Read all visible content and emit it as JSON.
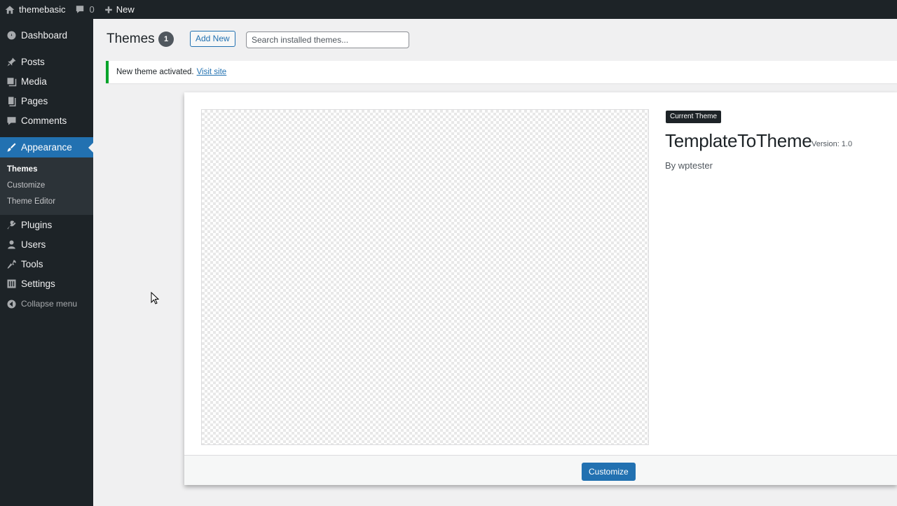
{
  "admin_bar": {
    "site_name": "themebasic",
    "comments_count": "0",
    "new_label": "New"
  },
  "sidebar": {
    "items": [
      {
        "label": "Dashboard",
        "icon": "dashboard-icon"
      },
      {
        "label": "Posts",
        "icon": "pushpin-icon"
      },
      {
        "label": "Media",
        "icon": "media-icon"
      },
      {
        "label": "Pages",
        "icon": "pages-icon"
      },
      {
        "label": "Comments",
        "icon": "comment-icon"
      },
      {
        "label": "Appearance",
        "icon": "paintbrush-icon",
        "active": true
      },
      {
        "label": "Plugins",
        "icon": "plugin-icon"
      },
      {
        "label": "Users",
        "icon": "user-icon"
      },
      {
        "label": "Tools",
        "icon": "wrench-icon"
      },
      {
        "label": "Settings",
        "icon": "settings-icon"
      }
    ],
    "appearance_submenu": [
      "Themes",
      "Customize",
      "Theme Editor"
    ],
    "collapse_label": "Collapse menu"
  },
  "header": {
    "title": "Themes",
    "count": "1",
    "add_new_label": "Add New",
    "search_placeholder": "Search installed themes..."
  },
  "notice": {
    "text": "New theme activated.",
    "link": "Visit site"
  },
  "theme": {
    "current_label": "Current Theme",
    "name": "TemplateToTheme",
    "version": "Version: 1.0",
    "author": "By wptester",
    "customize_label": "Customize"
  },
  "colors": {
    "accent": "#2271b1",
    "admin_dark": "#1d2327",
    "notice_success": "#00a32a"
  }
}
